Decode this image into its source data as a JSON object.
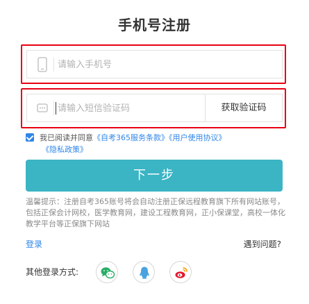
{
  "page": {
    "title": "手机号注册"
  },
  "phone": {
    "placeholder": "请输入手机号",
    "icon": "mobile-phone-icon"
  },
  "code": {
    "placeholder": "请输入短信验证码",
    "icon": "message-dots-icon",
    "button_label": "获取验证码"
  },
  "agreement": {
    "checked": true,
    "prefix": "我已阅读并同意",
    "service_terms": "《自考365服务条款》",
    "user_agreement": "《用户使用协议》",
    "privacy_policy": "《隐私政策》"
  },
  "next_button": {
    "label": "下一步"
  },
  "tip": {
    "text": "温馨提示：注册自考365账号将会自动注册正保远程教育旗下所有网站账号，包括正保会计网校，医学教育网，建设工程教育网，正小保课堂，高校一体化教学平台等正保旗下网站"
  },
  "footer": {
    "login_label": "登录",
    "help_label": "遇到问题?"
  },
  "social": {
    "label": "其他登录方式:",
    "items": [
      {
        "name": "wechat-icon",
        "color": "#2aae67"
      },
      {
        "name": "qq-icon",
        "color": "#4aa3df"
      },
      {
        "name": "weibo-icon",
        "color": "#e6162d"
      }
    ]
  },
  "colors": {
    "accent": "#3bb4c4",
    "link": "#2f86e8",
    "highlight_frame": "#e60012"
  }
}
